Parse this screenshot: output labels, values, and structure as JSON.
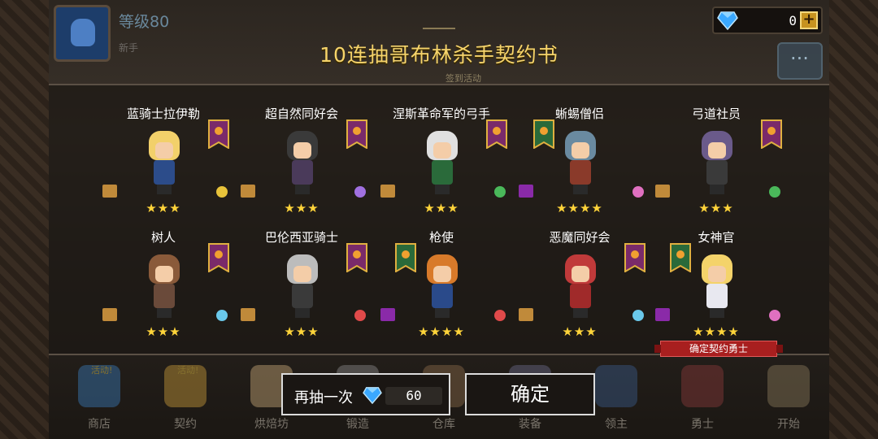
{
  "hud": {
    "level": "等级80",
    "title": "新手",
    "gems": "0"
  },
  "dialog": {
    "title": "10连抽哥布林杀手契约书",
    "subtitle": "签到活动"
  },
  "heroes": [
    {
      "name": "蓝骑士拉伊勒",
      "stars": "★★★",
      "hair": "#f2d06a",
      "outfit": "#2c4c8a",
      "element_color": "#e8c33a",
      "tag_color": "#c08a3a",
      "banner": "purple"
    },
    {
      "name": "超自然同好会",
      "stars": "★★★",
      "hair": "#3a3a3a",
      "outfit": "#4a3a5a",
      "element_color": "#a070e0",
      "tag_color": "#c08a3a",
      "banner": "purple"
    },
    {
      "name": "涅斯革命军的弓手",
      "stars": "★★★",
      "hair": "#e0e0e0",
      "outfit": "#2a6a3a",
      "element_color": "#4ab85a",
      "tag_color": "#c08a3a",
      "banner": "purple"
    },
    {
      "name": "蜥蜴僧侣",
      "stars": "★★★★",
      "hair": "#6a8aa0",
      "outfit": "#8a3a2a",
      "element_color": "#e070c0",
      "tag_color": "#8a2aa8",
      "banner": "green"
    },
    {
      "name": "弓道社员",
      "stars": "★★★",
      "hair": "#6a5a8a",
      "outfit": "#3a3a3a",
      "element_color": "#4ab85a",
      "tag_color": "#c08a3a",
      "banner": "purple"
    },
    {
      "name": "树人",
      "stars": "★★★",
      "hair": "#8a5a3a",
      "outfit": "#6a4a3a",
      "element_color": "#6ac8ea",
      "tag_color": "#c08a3a",
      "banner": "purple"
    },
    {
      "name": "巴伦西亚骑士",
      "stars": "★★★",
      "hair": "#bcbcbc",
      "outfit": "#3a3a3a",
      "element_color": "#e04a4a",
      "tag_color": "#c08a3a",
      "banner": "purple"
    },
    {
      "name": "枪使",
      "stars": "★★★★",
      "hair": "#d87a2a",
      "outfit": "#2a4a8a",
      "element_color": "#e04a4a",
      "tag_color": "#8a2aa8",
      "banner": "green"
    },
    {
      "name": "恶魔同好会",
      "stars": "★★★",
      "hair": "#c03a3a",
      "outfit": "#a02a2a",
      "element_color": "#6ac8ea",
      "tag_color": "#c08a3a",
      "banner": "purple"
    },
    {
      "name": "女神官",
      "stars": "★★★★",
      "hair": "#f4d36a",
      "outfit": "#e8e8f0",
      "element_color": "#e070c0",
      "tag_color": "#8a2aa8",
      "banner": "green"
    }
  ],
  "confirm_ribbon": "确定契约勇士",
  "nav": [
    {
      "label": "商店",
      "badge": "活动!",
      "color": "#3a7ab8"
    },
    {
      "label": "契约",
      "badge": "活动!",
      "color": "#c89a3a"
    },
    {
      "label": "烘焙坊",
      "badge": "",
      "color": "#c8a878"
    },
    {
      "label": "锻造",
      "badge": "",
      "color": "#8a8a8a"
    },
    {
      "label": "仓库",
      "badge": "",
      "color": "#8a6a4a"
    },
    {
      "label": "装备",
      "badge": "",
      "color": "#6a6a8a"
    },
    {
      "label": "领主",
      "badge": "",
      "color": "#3a5a8a"
    },
    {
      "label": "勇士",
      "badge": "",
      "color": "#8a3a3a"
    },
    {
      "label": "开始",
      "badge": "",
      "color": "#8a7a5a"
    }
  ],
  "buttons": {
    "again_label": "再抽一次",
    "again_cost": "60",
    "confirm_label": "确定"
  },
  "colors": {
    "gem": "#3aa8ff",
    "star": "#ffd43a",
    "title": "#f6d46a",
    "ribbon": "#a81f1f"
  }
}
